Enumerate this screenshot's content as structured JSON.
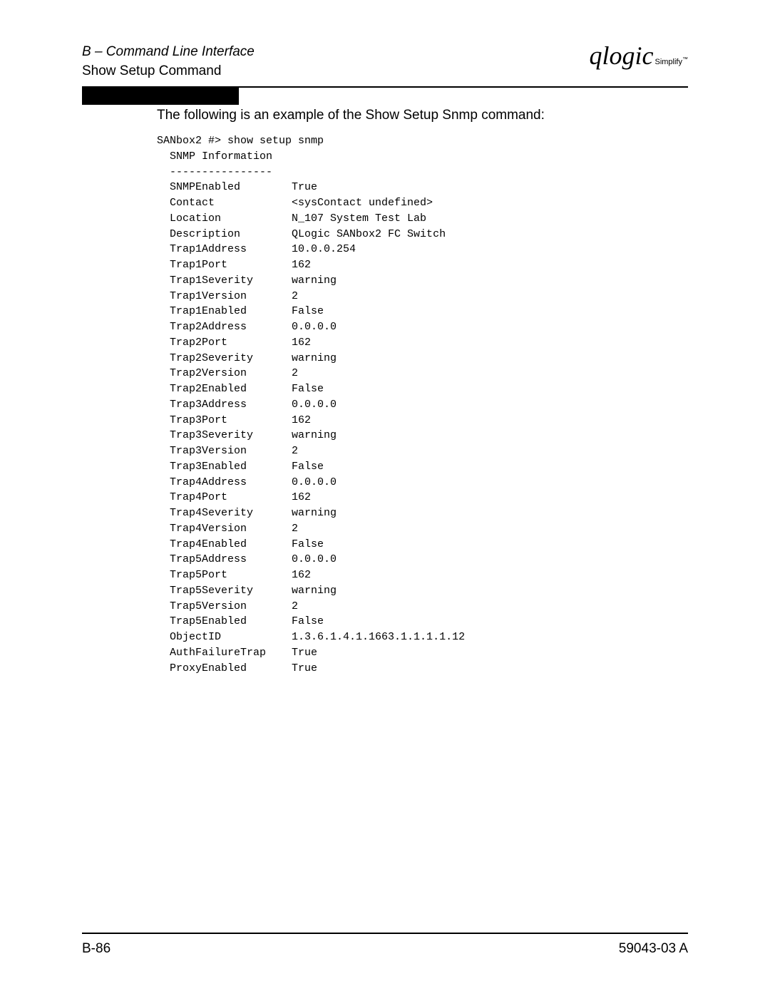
{
  "header": {
    "line1": "B – Command Line Interface",
    "line2": "Show Setup Command",
    "logo_main": "qlogic",
    "logo_sub": "Simplify",
    "logo_tm": "™"
  },
  "intro": "The following is an example of the Show Setup Snmp command:",
  "code": {
    "prompt": "SANbox2 #> show setup snmp",
    "section_title": "  SNMP Information",
    "divider": "  ----------------",
    "rows": [
      {
        "k": "  SNMPEnabled",
        "v": "True"
      },
      {
        "k": "  Contact",
        "v": "<sysContact undefined>"
      },
      {
        "k": "  Location",
        "v": "N_107 System Test Lab"
      },
      {
        "k": "  Description",
        "v": "QLogic SANbox2 FC Switch"
      },
      {
        "k": "  Trap1Address",
        "v": "10.0.0.254"
      },
      {
        "k": "  Trap1Port",
        "v": "162"
      },
      {
        "k": "  Trap1Severity",
        "v": "warning"
      },
      {
        "k": "  Trap1Version",
        "v": "2"
      },
      {
        "k": "  Trap1Enabled",
        "v": "False"
      },
      {
        "k": "  Trap2Address",
        "v": "0.0.0.0"
      },
      {
        "k": "  Trap2Port",
        "v": "162"
      },
      {
        "k": "  Trap2Severity",
        "v": "warning"
      },
      {
        "k": "  Trap2Version",
        "v": "2"
      },
      {
        "k": "  Trap2Enabled",
        "v": "False"
      },
      {
        "k": "  Trap3Address",
        "v": "0.0.0.0"
      },
      {
        "k": "  Trap3Port",
        "v": "162"
      },
      {
        "k": "  Trap3Severity",
        "v": "warning"
      },
      {
        "k": "  Trap3Version",
        "v": "2"
      },
      {
        "k": "  Trap3Enabled",
        "v": "False"
      },
      {
        "k": "  Trap4Address",
        "v": "0.0.0.0"
      },
      {
        "k": "  Trap4Port",
        "v": "162"
      },
      {
        "k": "  Trap4Severity",
        "v": "warning"
      },
      {
        "k": "  Trap4Version",
        "v": "2"
      },
      {
        "k": "  Trap4Enabled",
        "v": "False"
      },
      {
        "k": "  Trap5Address",
        "v": "0.0.0.0"
      },
      {
        "k": "  Trap5Port",
        "v": "162"
      },
      {
        "k": "  Trap5Severity",
        "v": "warning"
      },
      {
        "k": "  Trap5Version",
        "v": "2"
      },
      {
        "k": "  Trap5Enabled",
        "v": "False"
      },
      {
        "k": "  ObjectID",
        "v": "1.3.6.1.4.1.1663.1.1.1.1.12"
      },
      {
        "k": "  AuthFailureTrap",
        "v": "True"
      },
      {
        "k": "  ProxyEnabled",
        "v": "True"
      }
    ]
  },
  "footer": {
    "left": "B-86",
    "right": "59043-03  A"
  }
}
